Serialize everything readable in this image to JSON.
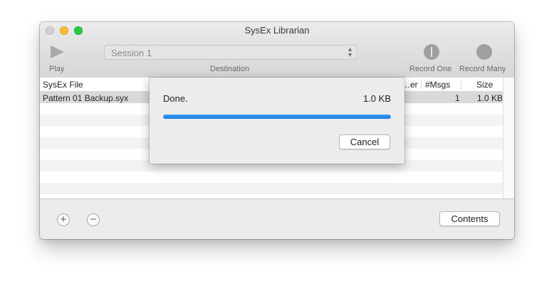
{
  "window": {
    "title": "SysEx Librarian"
  },
  "toolbar": {
    "play_label": "Play",
    "destination_label": "Destination",
    "destination_value": "Session 1",
    "record_one_label": "Record One",
    "record_many_label": "Record Many"
  },
  "table": {
    "columns": [
      "SysEx File",
      "…er",
      "#Msgs",
      "Size"
    ],
    "rows": [
      {
        "file": "Pattern 01 Backup.syx",
        "msgs": "1",
        "size": "1.0 KB"
      }
    ]
  },
  "bottom": {
    "add_symbol": "+",
    "remove_symbol": "−",
    "contents_label": "Contents"
  },
  "sheet": {
    "status": "Done.",
    "size": "1.0 KB",
    "progress_fraction": 1.0,
    "cancel_label": "Cancel"
  },
  "colors": {
    "progress": "#1b7fe3",
    "selection_row": "#d9d9d9"
  },
  "icons": [
    "play-icon",
    "record-one-icon",
    "record-many-icon",
    "add-icon",
    "remove-icon",
    "popup-arrows-icon"
  ]
}
